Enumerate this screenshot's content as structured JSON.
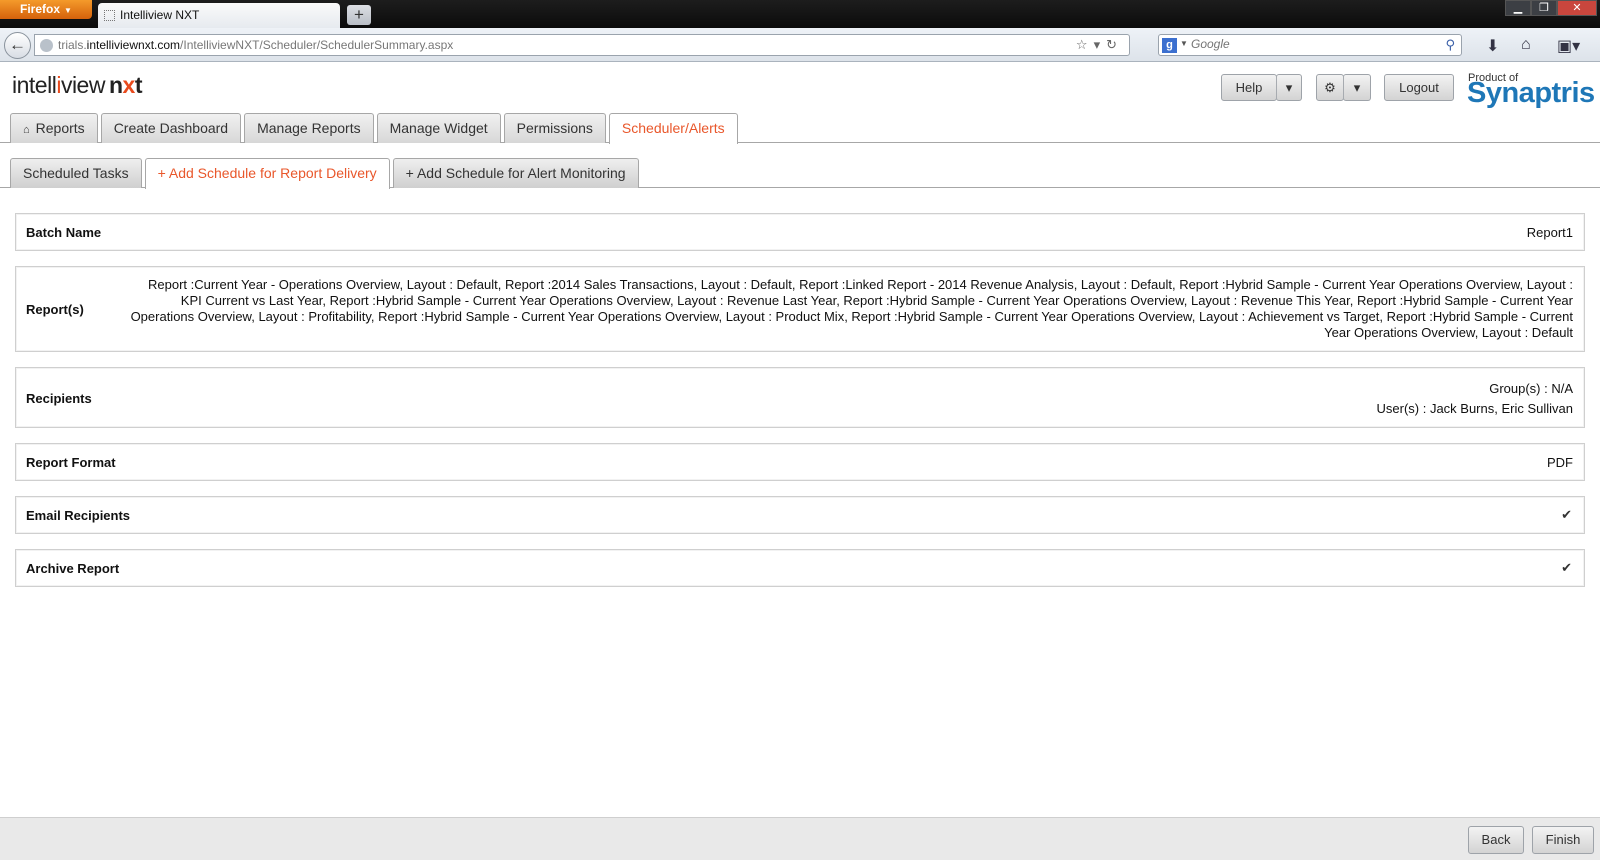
{
  "browser": {
    "app_button": "Firefox",
    "tab_title": "Intelliview NXT",
    "url_prefix": "trials.",
    "url_domain": "intelliviewnxt.com",
    "url_path": "/IntelliviewNXT/Scheduler/SchedulerSummary.aspx",
    "search_placeholder": "Google"
  },
  "header": {
    "logo_intell": "intell",
    "logo_i": "i",
    "logo_view": "view",
    "logo_n": "n",
    "logo_x": "x",
    "logo_t": "t",
    "help_label": "Help",
    "logout_label": "Logout",
    "product_of": "Product of",
    "brand": "Synaptris"
  },
  "main_tabs": [
    {
      "label": "Reports",
      "active": false
    },
    {
      "label": "Create Dashboard",
      "active": false
    },
    {
      "label": "Manage Reports",
      "active": false
    },
    {
      "label": "Manage Widget",
      "active": false
    },
    {
      "label": "Permissions",
      "active": false
    },
    {
      "label": "Scheduler/Alerts",
      "active": true
    }
  ],
  "sub_tabs": [
    {
      "label": "Scheduled Tasks",
      "active": false
    },
    {
      "label": "+ Add Schedule for Report Delivery",
      "active": true
    },
    {
      "label": "+ Add Schedule for Alert Monitoring",
      "active": false
    }
  ],
  "summary": {
    "batch_name_label": "Batch Name",
    "batch_name_value": "Report1",
    "reports_label": "Report(s)",
    "reports_value": "Report :Current Year - Operations Overview, Layout :  Default, Report :2014 Sales Transactions, Layout :  Default, Report :Linked Report - 2014 Revenue Analysis, Layout :  Default, Report :Hybrid Sample - Current Year Operations Overview, Layout :  KPI Current vs Last Year, Report :Hybrid Sample - Current Year Operations Overview, Layout :  Revenue Last Year, Report :Hybrid Sample - Current Year Operations Overview, Layout :  Revenue This Year, Report :Hybrid Sample - Current Year Operations Overview, Layout :  Profitability, Report :Hybrid Sample - Current Year Operations Overview, Layout :  Product Mix, Report :Hybrid Sample - Current Year Operations Overview, Layout :  Achievement vs Target, Report :Hybrid Sample - Current Year Operations Overview, Layout :  Default",
    "recipients_label": "Recipients",
    "groups_value": "Group(s) : N/A",
    "users_value": "User(s) : Jack Burns, Eric Sullivan",
    "format_label": "Report Format",
    "format_value": "PDF",
    "email_label": "Email Recipients",
    "archive_label": "Archive Report"
  },
  "footer": {
    "back_label": "Back",
    "finish_label": "Finish"
  }
}
